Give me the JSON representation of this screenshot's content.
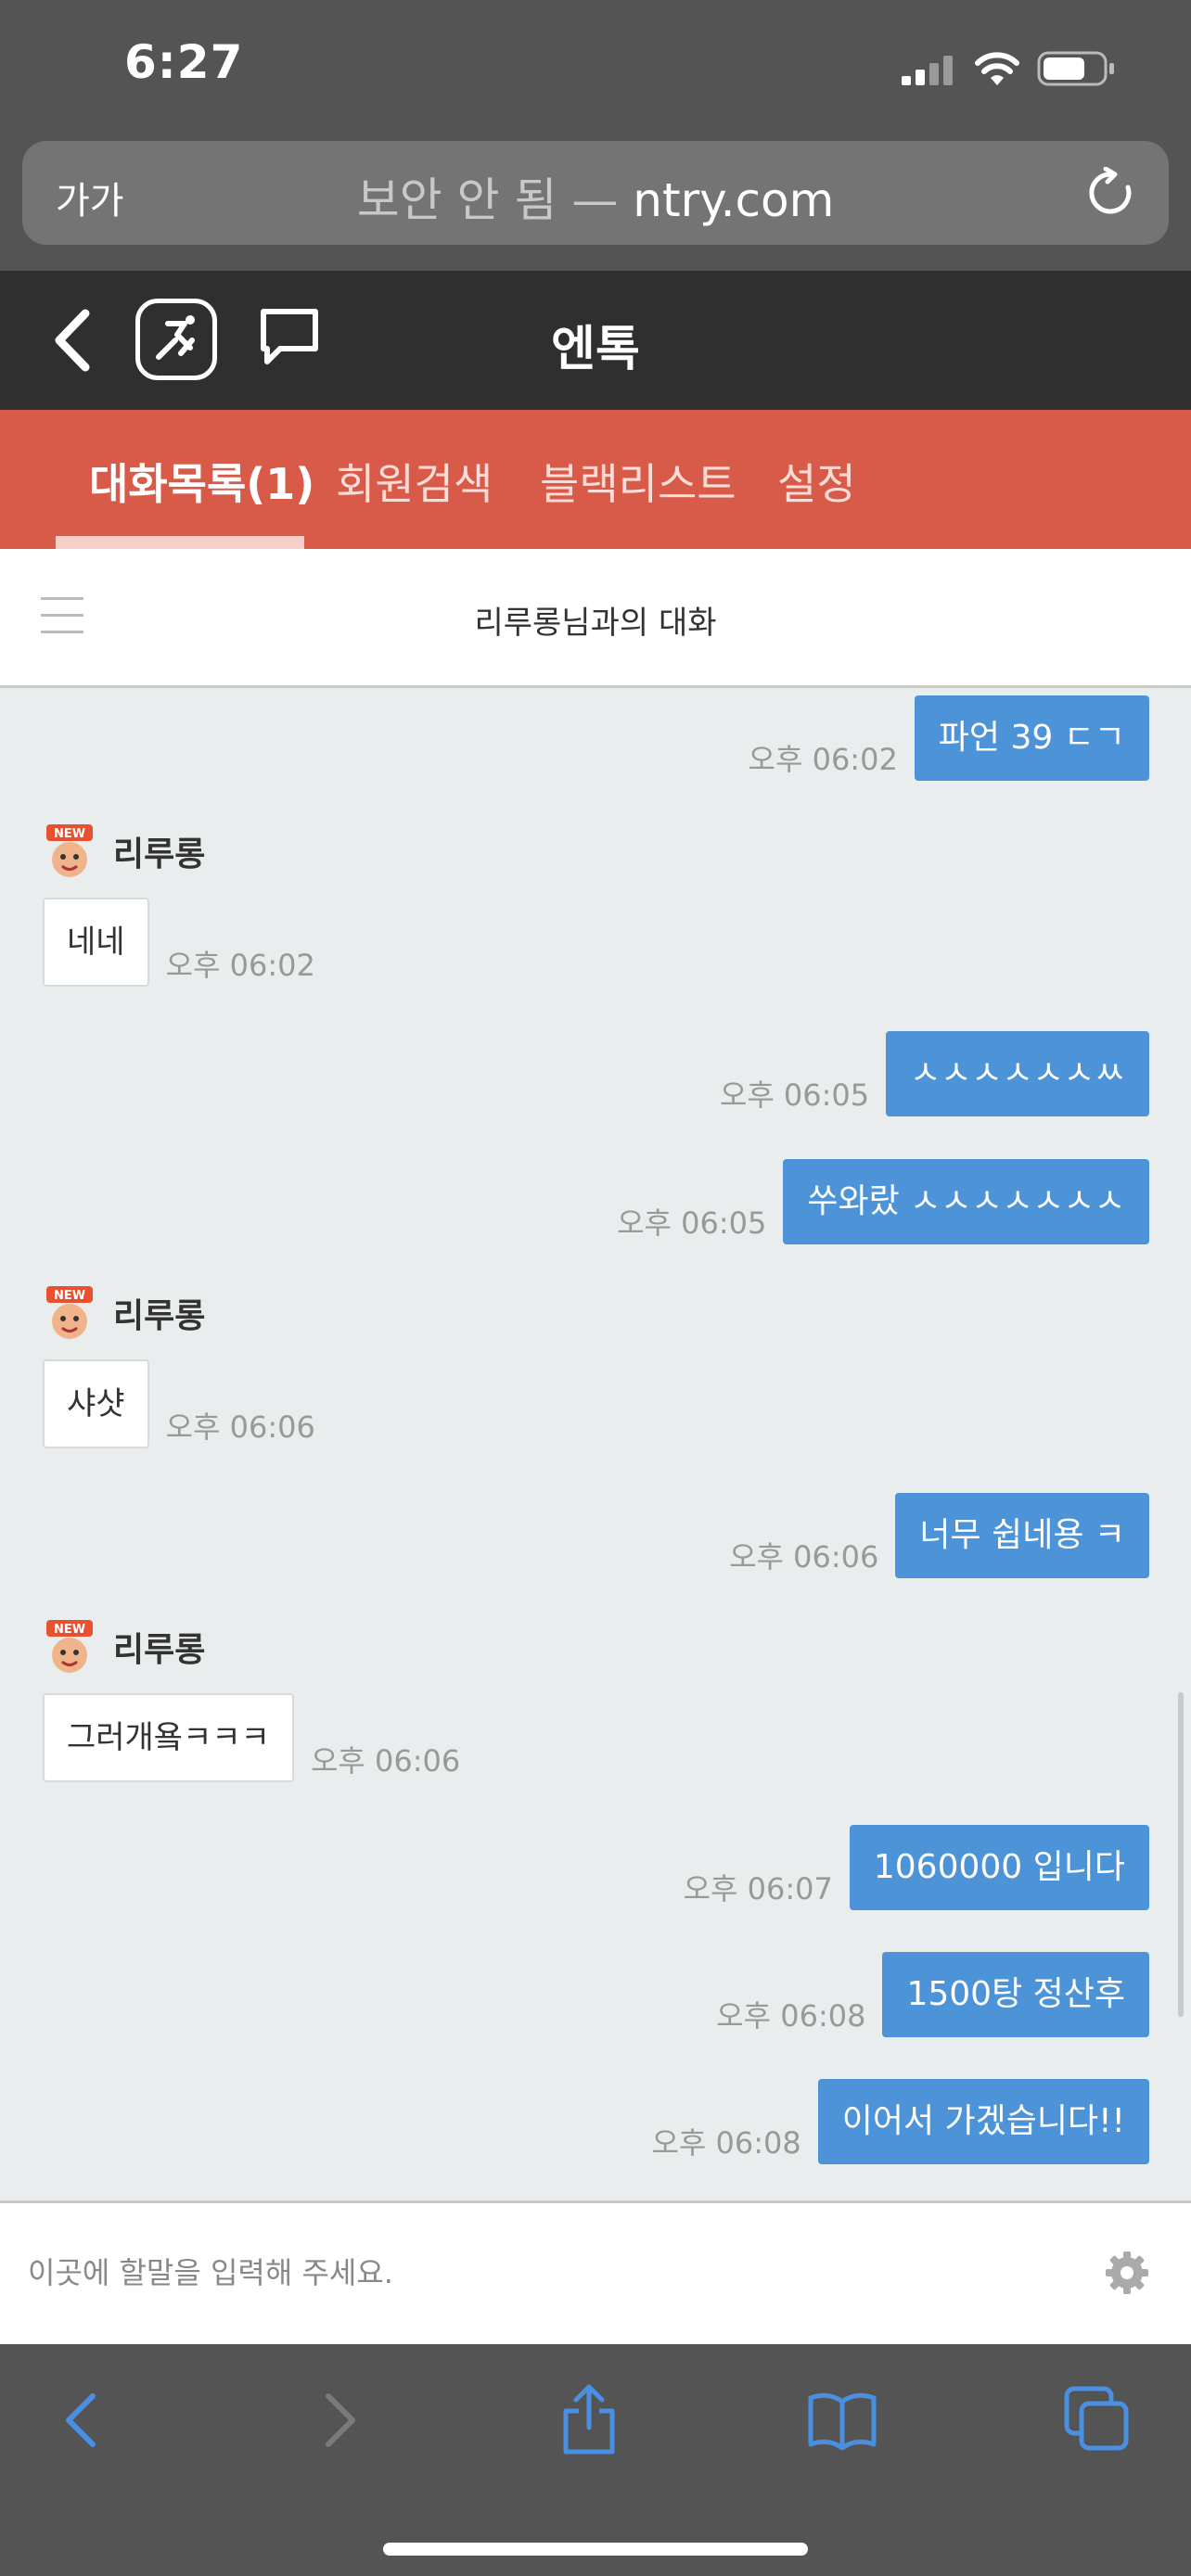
{
  "status_bar": {
    "time": "6:27"
  },
  "browser": {
    "text_size_label": "가가",
    "url_prefix": "보안 안 됨 —",
    "url_domain": "ntry.com"
  },
  "app": {
    "title": "엔톡"
  },
  "tabs": [
    {
      "label": "대화목록(1)",
      "active": true
    },
    {
      "label": "회원검색",
      "active": false
    },
    {
      "label": "블랙리스트",
      "active": false
    },
    {
      "label": "설정",
      "active": false
    }
  ],
  "conversation": {
    "title": "리루롱님과의 대화"
  },
  "messages": [
    {
      "dir": "out",
      "text": "파언 39 ㄷㄱ",
      "time": "오후 06:02"
    },
    {
      "dir": "in",
      "sender": "리루롱",
      "badge": "NEW",
      "text": "네네",
      "time": "오후 06:02"
    },
    {
      "dir": "out",
      "text": "ㅅㅅㅅㅅㅅㅅㅆ",
      "time": "오후 06:05"
    },
    {
      "dir": "out",
      "text": "쑤와랐 ㅅㅅㅅㅅㅅㅅㅅ",
      "time": "오후 06:05"
    },
    {
      "dir": "in",
      "sender": "리루롱",
      "badge": "NEW",
      "text": "샤샷",
      "time": "오후 06:06"
    },
    {
      "dir": "out",
      "text": "너무 쉽네용 ㅋ",
      "time": "오후 06:06"
    },
    {
      "dir": "in",
      "sender": "리루롱",
      "badge": "NEW",
      "text": "그러개욬ㅋㅋㅋ",
      "time": "오후 06:06"
    },
    {
      "dir": "out",
      "text": "1060000 입니다",
      "time": "오후 06:07"
    },
    {
      "dir": "out",
      "text": "1500탕 정산후",
      "time": "오후 06:08"
    },
    {
      "dir": "out",
      "text": "이어서 가겠습니다!!",
      "time": "오후 06:08"
    }
  ],
  "input": {
    "placeholder": "이곳에 할말을 입력해 주세요."
  },
  "colors": {
    "tab_bar": "#d85a48",
    "header": "#2f2f2f",
    "outgoing_bubble": "#4d93d8",
    "browser_chrome": "#545454",
    "toolbar_icon": "#4a90e2"
  },
  "icons": {
    "status": [
      "cellular-signal-icon",
      "wifi-icon",
      "battery-icon"
    ],
    "browser": [
      "reload-icon"
    ],
    "header": [
      "back-chevron-icon",
      "ntry-logo-icon",
      "chat-bubble-icon"
    ],
    "toolbar": [
      "back-arrow-icon",
      "forward-arrow-icon",
      "share-icon",
      "bookmarks-icon",
      "tabs-icon"
    ]
  }
}
